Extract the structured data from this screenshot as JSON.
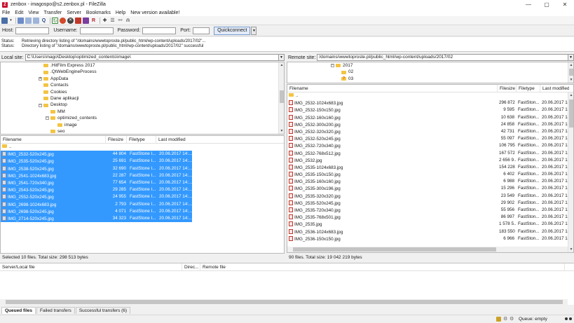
{
  "window": {
    "title": "zenbox - imagospo@s2.zenbox.pl - FileZilla",
    "controls": [
      "—",
      "▢",
      "✕"
    ]
  },
  "menu": [
    "File",
    "Edit",
    "View",
    "Transfer",
    "Server",
    "Bookmarks",
    "Help",
    "New version available!"
  ],
  "quickconnect": {
    "host_label": "Host:",
    "host_value": "",
    "username_label": "Username:",
    "username_value": "",
    "password_label": "Password:",
    "password_value": "",
    "port_label": "Port:",
    "port_value": "",
    "button_label": "Quickconnect",
    "dropdown_glyph": "▼"
  },
  "log": [
    {
      "label": "Status:",
      "text": "Retrieving directory listing of \"/domains/wwwtoproste.pl/public_html/wp-content/uploads/2017/02\"..."
    },
    {
      "label": "Status:",
      "text": "Directory listing of \"/domains/wwwtoproste.pl/public_html/wp-content/uploads/2017/02\" successful"
    }
  ],
  "local": {
    "site_label": "Local site:",
    "path": "C:\\Users\\mago\\Desktop\\optimized_contents\\image\\",
    "tree": [
      {
        "indent": 0,
        "expander": "",
        "name": ".HitFilm Express 2017"
      },
      {
        "indent": 0,
        "expander": "",
        "name": ".QtWebEngineProcess"
      },
      {
        "indent": 0,
        "expander": "+",
        "name": "AppData"
      },
      {
        "indent": 0,
        "expander": "",
        "name": "Contacts"
      },
      {
        "indent": 0,
        "expander": "",
        "name": "Cookies"
      },
      {
        "indent": 0,
        "expander": "",
        "name": "Dane aplikacji"
      },
      {
        "indent": 0,
        "expander": "−",
        "name": "Desktop"
      },
      {
        "indent": 1,
        "expander": "",
        "name": "MM"
      },
      {
        "indent": 1,
        "expander": "−",
        "name": "optimized_contents"
      },
      {
        "indent": 2,
        "expander": "",
        "name": "image"
      },
      {
        "indent": 1,
        "expander": "",
        "name": "seo"
      }
    ],
    "columns": [
      "Filename",
      "Filesize",
      "Filetype",
      "Last modified"
    ],
    "parent_dir": "..",
    "files": [
      {
        "name": "IMG_2532-520x245.jpg",
        "size": "44 804",
        "type": "FastStone I...",
        "modified": "20.06.2017 14:..."
      },
      {
        "name": "IMG_2535-520x245.jpg",
        "size": "25 691",
        "type": "FastStone I...",
        "modified": "20.06.2017 14:..."
      },
      {
        "name": "IMG_2538-520x245.jpg",
        "size": "32 690",
        "type": "FastStone I...",
        "modified": "20.06.2017 14:..."
      },
      {
        "name": "IMG_2541-1024x683.jpg",
        "size": "22 287",
        "type": "FastStone I...",
        "modified": "20.06.2017 14:..."
      },
      {
        "name": "IMG_2541-720x340.jpg",
        "size": "77 654",
        "type": "FastStone I...",
        "modified": "20.06.2017 14:..."
      },
      {
        "name": "IMG_2543-520x245.jpg",
        "size": "29 285",
        "type": "FastStone I...",
        "modified": "20.06.2017 14:..."
      },
      {
        "name": "IMG_2552-520x245.jpg",
        "size": "24 955",
        "type": "FastStone I...",
        "modified": "20.06.2017 14:..."
      },
      {
        "name": "IMG_2698-1024x683.jpg",
        "size": "2 793",
        "type": "FastStone I...",
        "modified": "20.06.2017 14:..."
      },
      {
        "name": "IMG_2698-520x245.jpg",
        "size": "4 071",
        "type": "FastStone I...",
        "modified": "20.06.2017 14:..."
      },
      {
        "name": "IMG_2714-520x245.jpg",
        "size": "34 323",
        "type": "FastStone I...",
        "modified": "20.06.2017 14:..."
      }
    ],
    "status": "Selected 10 files. Total size: 298 513 bytes"
  },
  "remote": {
    "site_label": "Remote site:",
    "path": "/domains/wwwtoproste.pl/public_html/wp-content/uploads/2017/02",
    "tree": [
      {
        "indent": 0,
        "expander": "−",
        "name": "2017",
        "icon": "folder"
      },
      {
        "indent": 1,
        "expander": "",
        "name": "02",
        "icon": "folder"
      },
      {
        "indent": 1,
        "expander": "",
        "name": "03",
        "icon": "unknown-folder"
      }
    ],
    "columns": [
      "Filename",
      "Filesize",
      "Filetype",
      "Last modified"
    ],
    "parent_dir": "..",
    "files": [
      {
        "name": "IMG_2532-1024x683.jpg",
        "size": "296 872",
        "type": "FastSton...",
        "modified": "20.06.2017 16"
      },
      {
        "name": "IMG_2532-150x150.jpg",
        "size": "9 595",
        "type": "FastSton...",
        "modified": "20.06.2017 16"
      },
      {
        "name": "IMG_2532-160x160.jpg",
        "size": "10 638",
        "type": "FastSton...",
        "modified": "20.06.2017 16"
      },
      {
        "name": "IMG_2532-300x200.jpg",
        "size": "24 858",
        "type": "FastSton...",
        "modified": "20.06.2017 16"
      },
      {
        "name": "IMG_2532-320x320.jpg",
        "size": "42 731",
        "type": "FastSton...",
        "modified": "20.06.2017 16"
      },
      {
        "name": "IMG_2532-520x245.jpg",
        "size": "55 097",
        "type": "FastSton...",
        "modified": "20.06.2017 16"
      },
      {
        "name": "IMG_2532-720x340.jpg",
        "size": "106 795",
        "type": "FastSton...",
        "modified": "20.06.2017 16"
      },
      {
        "name": "IMG_2532-768x512.jpg",
        "size": "167 572",
        "type": "FastSton...",
        "modified": "20.06.2017 16"
      },
      {
        "name": "IMG_2532.jpg",
        "size": "2 656 9...",
        "type": "FastSton...",
        "modified": "20.06.2017 15"
      },
      {
        "name": "IMG_2535-1024x683.jpg",
        "size": "154 228",
        "type": "FastSton...",
        "modified": "20.06.2017 16"
      },
      {
        "name": "IMG_2535-150x150.jpg",
        "size": "6 402",
        "type": "FastSton...",
        "modified": "20.06.2017 16"
      },
      {
        "name": "IMG_2535-160x160.jpg",
        "size": "6 988",
        "type": "FastSton...",
        "modified": "20.06.2017 16"
      },
      {
        "name": "IMG_2535-300x196.jpg",
        "size": "15 296",
        "type": "FastSton...",
        "modified": "20.06.2017 16"
      },
      {
        "name": "IMG_2535-320x320.jpg",
        "size": "23 549",
        "type": "FastSton...",
        "modified": "20.06.2017 16"
      },
      {
        "name": "IMG_2535-520x245.jpg",
        "size": "29 902",
        "type": "FastSton...",
        "modified": "20.06.2017 16"
      },
      {
        "name": "IMG_2535-720x340.jpg",
        "size": "55 956",
        "type": "FastSton...",
        "modified": "20.06.2017 16"
      },
      {
        "name": "IMG_2535-768x501.jpg",
        "size": "86 997",
        "type": "FastSton...",
        "modified": "20.06.2017 16"
      },
      {
        "name": "IMG_2535.jpg",
        "size": "1 578 5...",
        "type": "FastSton...",
        "modified": "20.06.2017 15"
      },
      {
        "name": "IMG_2536-1024x683.jpg",
        "size": "183 550",
        "type": "FastSton...",
        "modified": "20.06.2017 16"
      },
      {
        "name": "IMG_2536-150x150.jpg",
        "size": "6 966",
        "type": "FastSton...",
        "modified": "20.06.2017 16"
      }
    ],
    "status": "90 files. Total size: 19 042 219 bytes"
  },
  "queue": {
    "columns": [
      "Server/Local file",
      "Direc...",
      "Remote file"
    ],
    "tabs": [
      "Queued files",
      "Failed transfers",
      "Successful transfers (6)"
    ],
    "status": "Queue: empty"
  },
  "colors": {
    "selection": "#3399ff",
    "folder": "#f3c443",
    "brand": "#c8102e"
  }
}
